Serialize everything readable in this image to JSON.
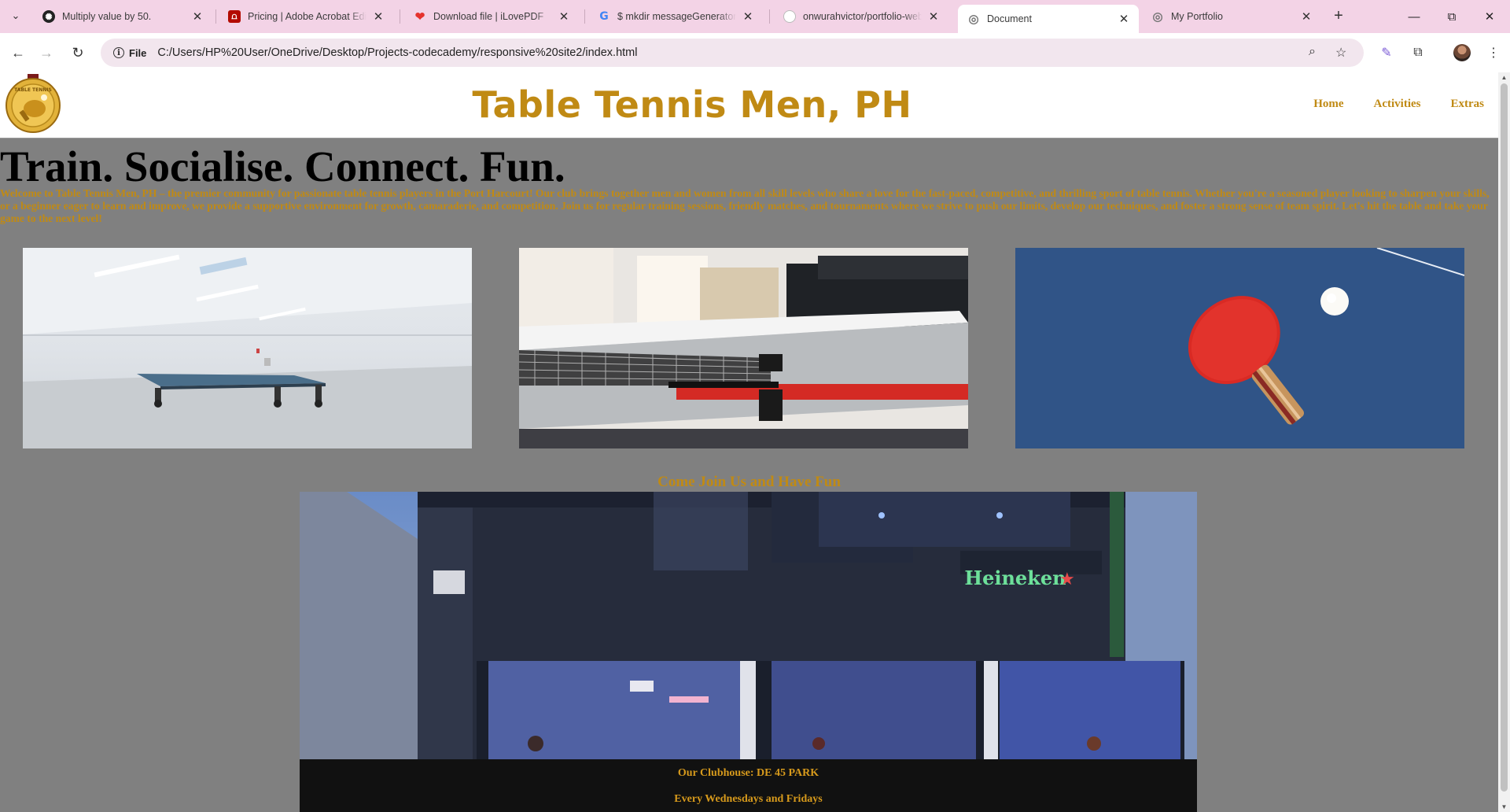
{
  "browser": {
    "tabs": [
      {
        "title": "Multiply value by 50.",
        "favicon": "openai-icon"
      },
      {
        "title": "Pricing | Adobe Acrobat Edit a PDF",
        "favicon": "adobe-acrobat-icon"
      },
      {
        "title": "Download file | iLovePDF",
        "favicon": "ilovepdf-heart-icon"
      },
      {
        "title": "$ mkdir messageGenerator mkdir",
        "favicon": "google-icon"
      },
      {
        "title": "onwurahvictor/portfolio-website",
        "favicon": "github-icon"
      },
      {
        "title": "Document",
        "favicon": "globe-icon",
        "active": true
      },
      {
        "title": "My Portfolio",
        "favicon": "globe-icon"
      }
    ],
    "address": {
      "scheme_label": "File",
      "url": "C:/Users/HP%20User/OneDrive/Desktop/Projects-codecademy/responsive%20site2/index.html"
    }
  },
  "site": {
    "title": "Table Tennis Men, PH",
    "nav": [
      "Home",
      "Activities",
      "Extras"
    ],
    "hero_heading": "Train. Socialise. Connect. Fun.",
    "intro": "Welcome to Table Tennis Men, PH – the premier community for passionate table tennis players in the Port Harcourt! Our club brings together men and women from all skill levels who share a love for the fast-paced, competitive, and thrilling sport of table tennis. Whether you're a seasoned player looking to sharpen your skills, or a beginner eager to learn and improve, we provide a supportive environment for growth, camaraderie, and competition. Join us for regular training sessions, friendly matches, and tournaments where we strive to push our limits, develop our techniques, and foster a strong sense of team spirit. Let's hit the table and take your game to the next level!",
    "join_title": "Come Join Us and Have Fun",
    "clubhouse": "Our Clubhouse: DE 45 PARK",
    "schedule": "Every Wednesdays and Fridays",
    "logo_text": "TABLE TENNIS",
    "clubhouse_sign": "Heineken"
  },
  "colors": {
    "accent_gold": "#c08a14",
    "page_bg": "#808080",
    "chrome_pink": "#f3d3e6",
    "footer_bg": "#111111"
  }
}
